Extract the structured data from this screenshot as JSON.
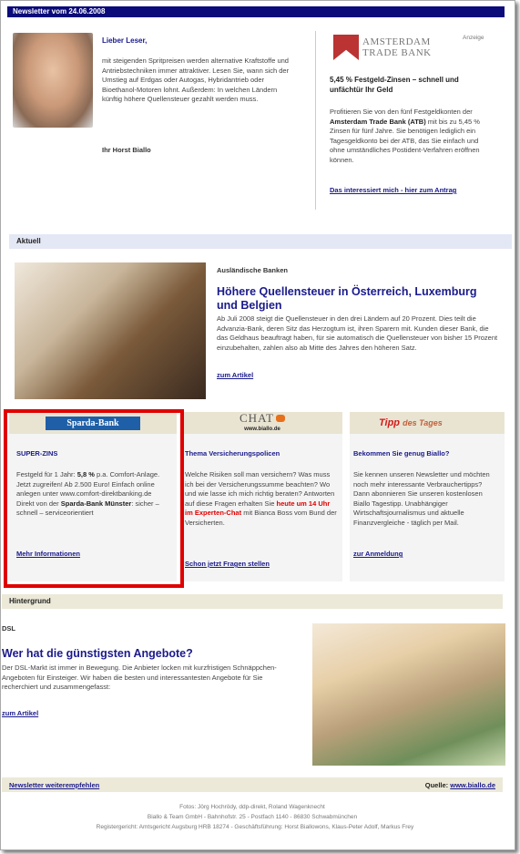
{
  "newsletter": {
    "title": "Newsletter vom 24.06.2008"
  },
  "intro": {
    "greeting": "Lieber Leser,",
    "body": "mit steigenden Spritpreisen werden alternative Kraftstoffe und Antriebstechniken immer attraktiver. Lesen Sie, wann sich der Umstieg auf Erdgas oder Autogas, Hybridantrieb oder Bioethanol-Motoren lohnt. Außerdem: In welchen Ländern künftig höhere Quellensteuer gezahlt werden muss.",
    "signature": "Ihr Horst Biallo"
  },
  "ad": {
    "logo_line1": "AMSTERDAM",
    "logo_line2": "TRADE BANK",
    "tag": "Anzeige",
    "headline": "5,45 % Festgeld-Zinsen – schnell und unfächtür Ihr Geld",
    "body_pre": "Profitieren Sie von den fünf Festgeldkonten der ",
    "body_bold": "Amsterdam Trade Bank (ATB)",
    "body_post": " mit bis zu 5,45 % Zinsen für fünf Jahre. Sie benötigen lediglich ein Tagesgeldkonto bei der ATB, das Sie einfach und ohne umständliches Postident-Verfahren eröffnen können.",
    "link": "Das interessiert mich - hier zum Antrag"
  },
  "sections": {
    "aktuell": "Aktuell",
    "hintergrund": "Hintergrund"
  },
  "article1": {
    "kicker": "Ausländische Banken",
    "title": "Höhere Quellensteuer in Österreich, Luxemburg und Belgien",
    "body": "Ab Juli 2008 steigt die Quellensteuer in den drei Ländern auf 20 Prozent. Dies teilt die Advanzia-Bank, deren Sitz das Herzogtum ist, ihren Sparern mit. Kunden dieser Bank, die das Geldhaus beauftragt haben, für sie automatisch die Quellensteuer von bisher 15 Prozent einzubehalten, zahlen also ab Mitte des Jahres den höheren Satz.",
    "link": "zum Artikel"
  },
  "col1": {
    "logo": "Sparda-Bank",
    "title": "SUPER-ZINS",
    "body_pre": "Festgeld für 1 Jahr: ",
    "rate": "5,8 %",
    "body_mid": " p.a. Comfort-Anlage. Jetzt zugreifen! Ab 2.500 Euro! Einfach online anlegen unter www.comfort-direktbanking.de Direkt von der ",
    "body_bold": "Sparda-Bank Münster",
    "body_post": ": sicher – schnell – serviceorientiert",
    "link": "Mehr Informationen"
  },
  "col2": {
    "logo": "CHAT",
    "logo_sub": "www.biallo.de",
    "title": "Thema Versicherungspolicen",
    "body_pre": "Welche Risiken soll man versichern? Was muss ich bei der Versicherungssumme beachten? Wo und wie lasse ich mich richtig beraten? Antworten auf diese Fragen erhalten Sie ",
    "highlight": "heute um 14 Uhr im Experten-Chat",
    "body_post": " mit Bianca Boss vom Bund der Versicherten.",
    "link": "Schon jetzt Fragen stellen"
  },
  "col3": {
    "logo_red": "Tipp",
    "logo_rest": "des Tages",
    "title": "Bekommen Sie genug Biallo?",
    "body": "Sie kennen unseren Newsletter und möchten noch mehr interessante Verbrauchertipps? Dann abonnieren Sie unseren kostenlosen Biallo Tagestipp. Unabhängiger Wirtschaftsjournalismus und aktuelle Finanzvergleiche - täglich per Mail.",
    "link": "zur Anmeldung"
  },
  "article2": {
    "kicker": "DSL",
    "title": "Wer hat die günstigsten Angebote?",
    "body": "Der DSL-Markt ist immer in Bewegung. Die Anbieter locken mit kurzfristigen Schnäppchen-Angeboten für Einsteiger. Wir haben die besten und interessantesten Angebote für Sie recherchiert und zusammengefasst:",
    "link": "zum Artikel"
  },
  "footer": {
    "recommend": "Newsletter weiterempfehlen",
    "source_label": "Quelle:",
    "source_link": "www.biallo.de",
    "line1": "Fotos: Jörg Hochrödy, ddp-direkt, Roland Wagenknecht",
    "line2": "Biallo & Team GmbH - Bahnhofstr. 25 - Postfach 1140 - 86830 Schwabmünchen",
    "line3": "Registergericht: Amtsgericht Augsburg HRB 18274 - Geschäftsführung: Horst Biallowons, Klaus-Peter Adolf, Markus Frey"
  },
  "colors": {
    "navy": "#0b0b7a",
    "link": "#1a1a8c",
    "highlight": "#e00000"
  }
}
